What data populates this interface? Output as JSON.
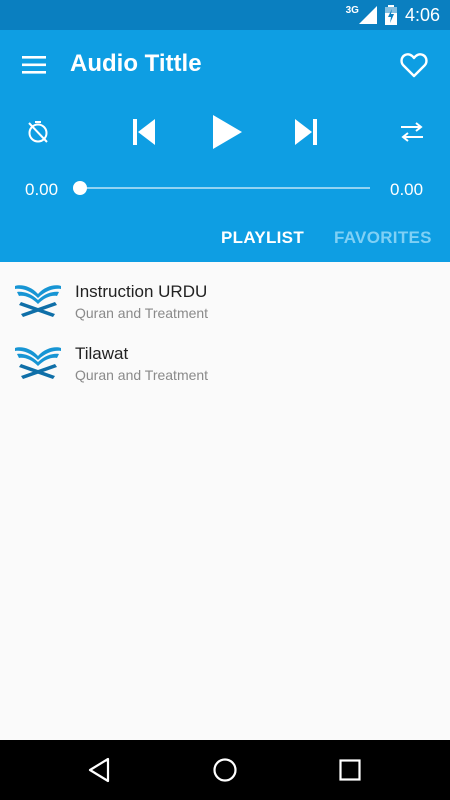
{
  "status_bar": {
    "network": "3G",
    "time": "4:06"
  },
  "app_bar": {
    "title": "Audio Tittle"
  },
  "player": {
    "elapsed": "0.00",
    "duration": "0.00",
    "progress": 0
  },
  "tabs": [
    {
      "label": "PLAYLIST",
      "active": true
    },
    {
      "label": "FAVORITES",
      "active": false
    }
  ],
  "playlist": [
    {
      "title": "Instruction URDU",
      "subtitle": "Quran and Treatment",
      "icon": "quran-book-icon"
    },
    {
      "title": "Tilawat",
      "subtitle": "Quran and Treatment",
      "icon": "quran-book-icon"
    }
  ],
  "colors": {
    "status_bar": "#0a7fc0",
    "header": "#0e9ee3",
    "accent": "#0e9ee3",
    "tab_inactive": "#7fd0f5"
  },
  "icons": [
    "menu-icon",
    "heart-icon",
    "timer-off-icon",
    "skip-previous-icon",
    "play-icon",
    "skip-next-icon",
    "repeat-icon",
    "back-icon",
    "home-icon",
    "recents-icon"
  ]
}
